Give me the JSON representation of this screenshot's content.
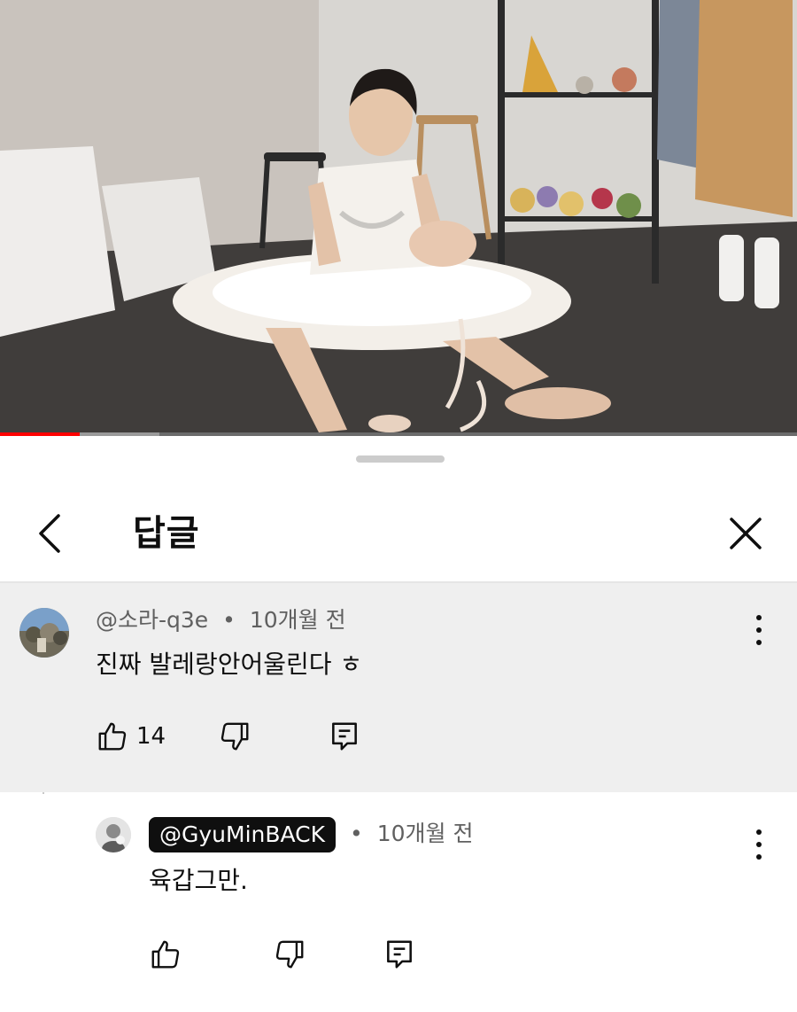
{
  "video": {
    "progress_fraction": 0.1,
    "buffered_fraction": 0.2,
    "colors": {
      "progress": "#ff0000",
      "buffer": "#9a9a9a",
      "track": "#6b6b6b"
    }
  },
  "sheet": {
    "title": "답글",
    "back_icon": "chevron-left-icon",
    "close_icon": "close-icon"
  },
  "comments": [
    {
      "author": "@소라-q3e",
      "separator": "•",
      "time": "10개월 전",
      "text": "진짜 발레랑안어울린다 ㅎ",
      "likes": "14",
      "highlighted": true
    },
    {
      "author": "@GyuMinBACK",
      "separator": "•",
      "time": "10개월 전",
      "text": "육갑그만.",
      "likes": "",
      "author_chip_color": "#0f0f0f"
    }
  ]
}
